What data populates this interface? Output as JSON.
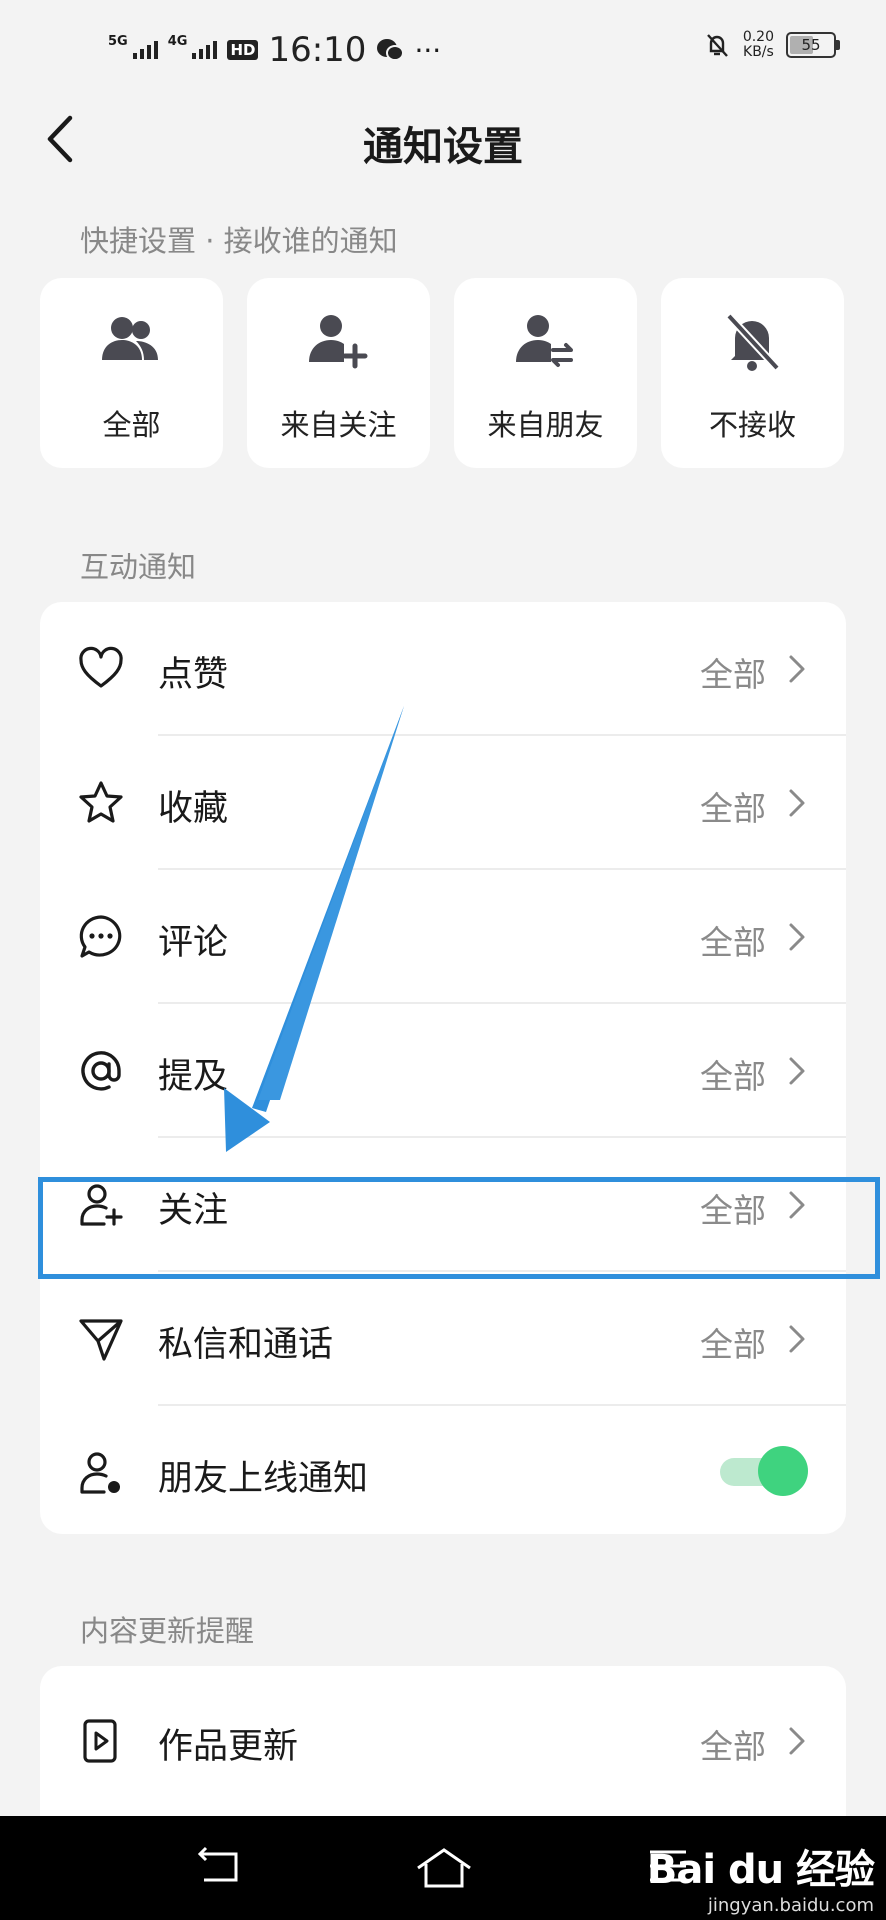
{
  "status_bar": {
    "sig1": "5G",
    "sig2": "4G",
    "hd": "HD",
    "time": "16:10",
    "dots": "···",
    "net_speed": "0.20",
    "net_unit": "KB/s",
    "battery": "55",
    "battery_level": 0.55
  },
  "nav": {
    "title": "通知设置"
  },
  "quick": {
    "header": "快捷设置 · 接收谁的通知",
    "items": [
      {
        "label": "全部",
        "icon": "group-icon"
      },
      {
        "label": "来自关注",
        "icon": "user-add-icon"
      },
      {
        "label": "来自朋友",
        "icon": "user-swap-icon"
      },
      {
        "label": "不接收",
        "icon": "bell-off-icon"
      }
    ]
  },
  "interaction": {
    "header": "互动通知",
    "rows": [
      {
        "label": "点赞",
        "value": "全部",
        "icon": "heart-icon"
      },
      {
        "label": "收藏",
        "value": "全部",
        "icon": "star-icon"
      },
      {
        "label": "评论",
        "value": "全部",
        "icon": "comment-icon"
      },
      {
        "label": "提及",
        "value": "全部",
        "icon": "at-icon"
      },
      {
        "label": "关注",
        "value": "全部",
        "icon": "user-plus-icon"
      },
      {
        "label": "私信和通话",
        "value": "全部",
        "icon": "send-icon"
      },
      {
        "label": "朋友上线通知",
        "icon": "user-online-icon",
        "toggle_on": true
      }
    ]
  },
  "content": {
    "header": "内容更新提醒",
    "rows": [
      {
        "label": "作品更新",
        "value": "全部",
        "icon": "video-icon"
      }
    ]
  },
  "watermark": {
    "logo": "Bai du 经验",
    "url": "jingyan.baidu.com"
  },
  "colors": {
    "accent_blue": "#2f8fdc",
    "toggle_green": "#3fd37f",
    "background": "#f3f3f3"
  }
}
